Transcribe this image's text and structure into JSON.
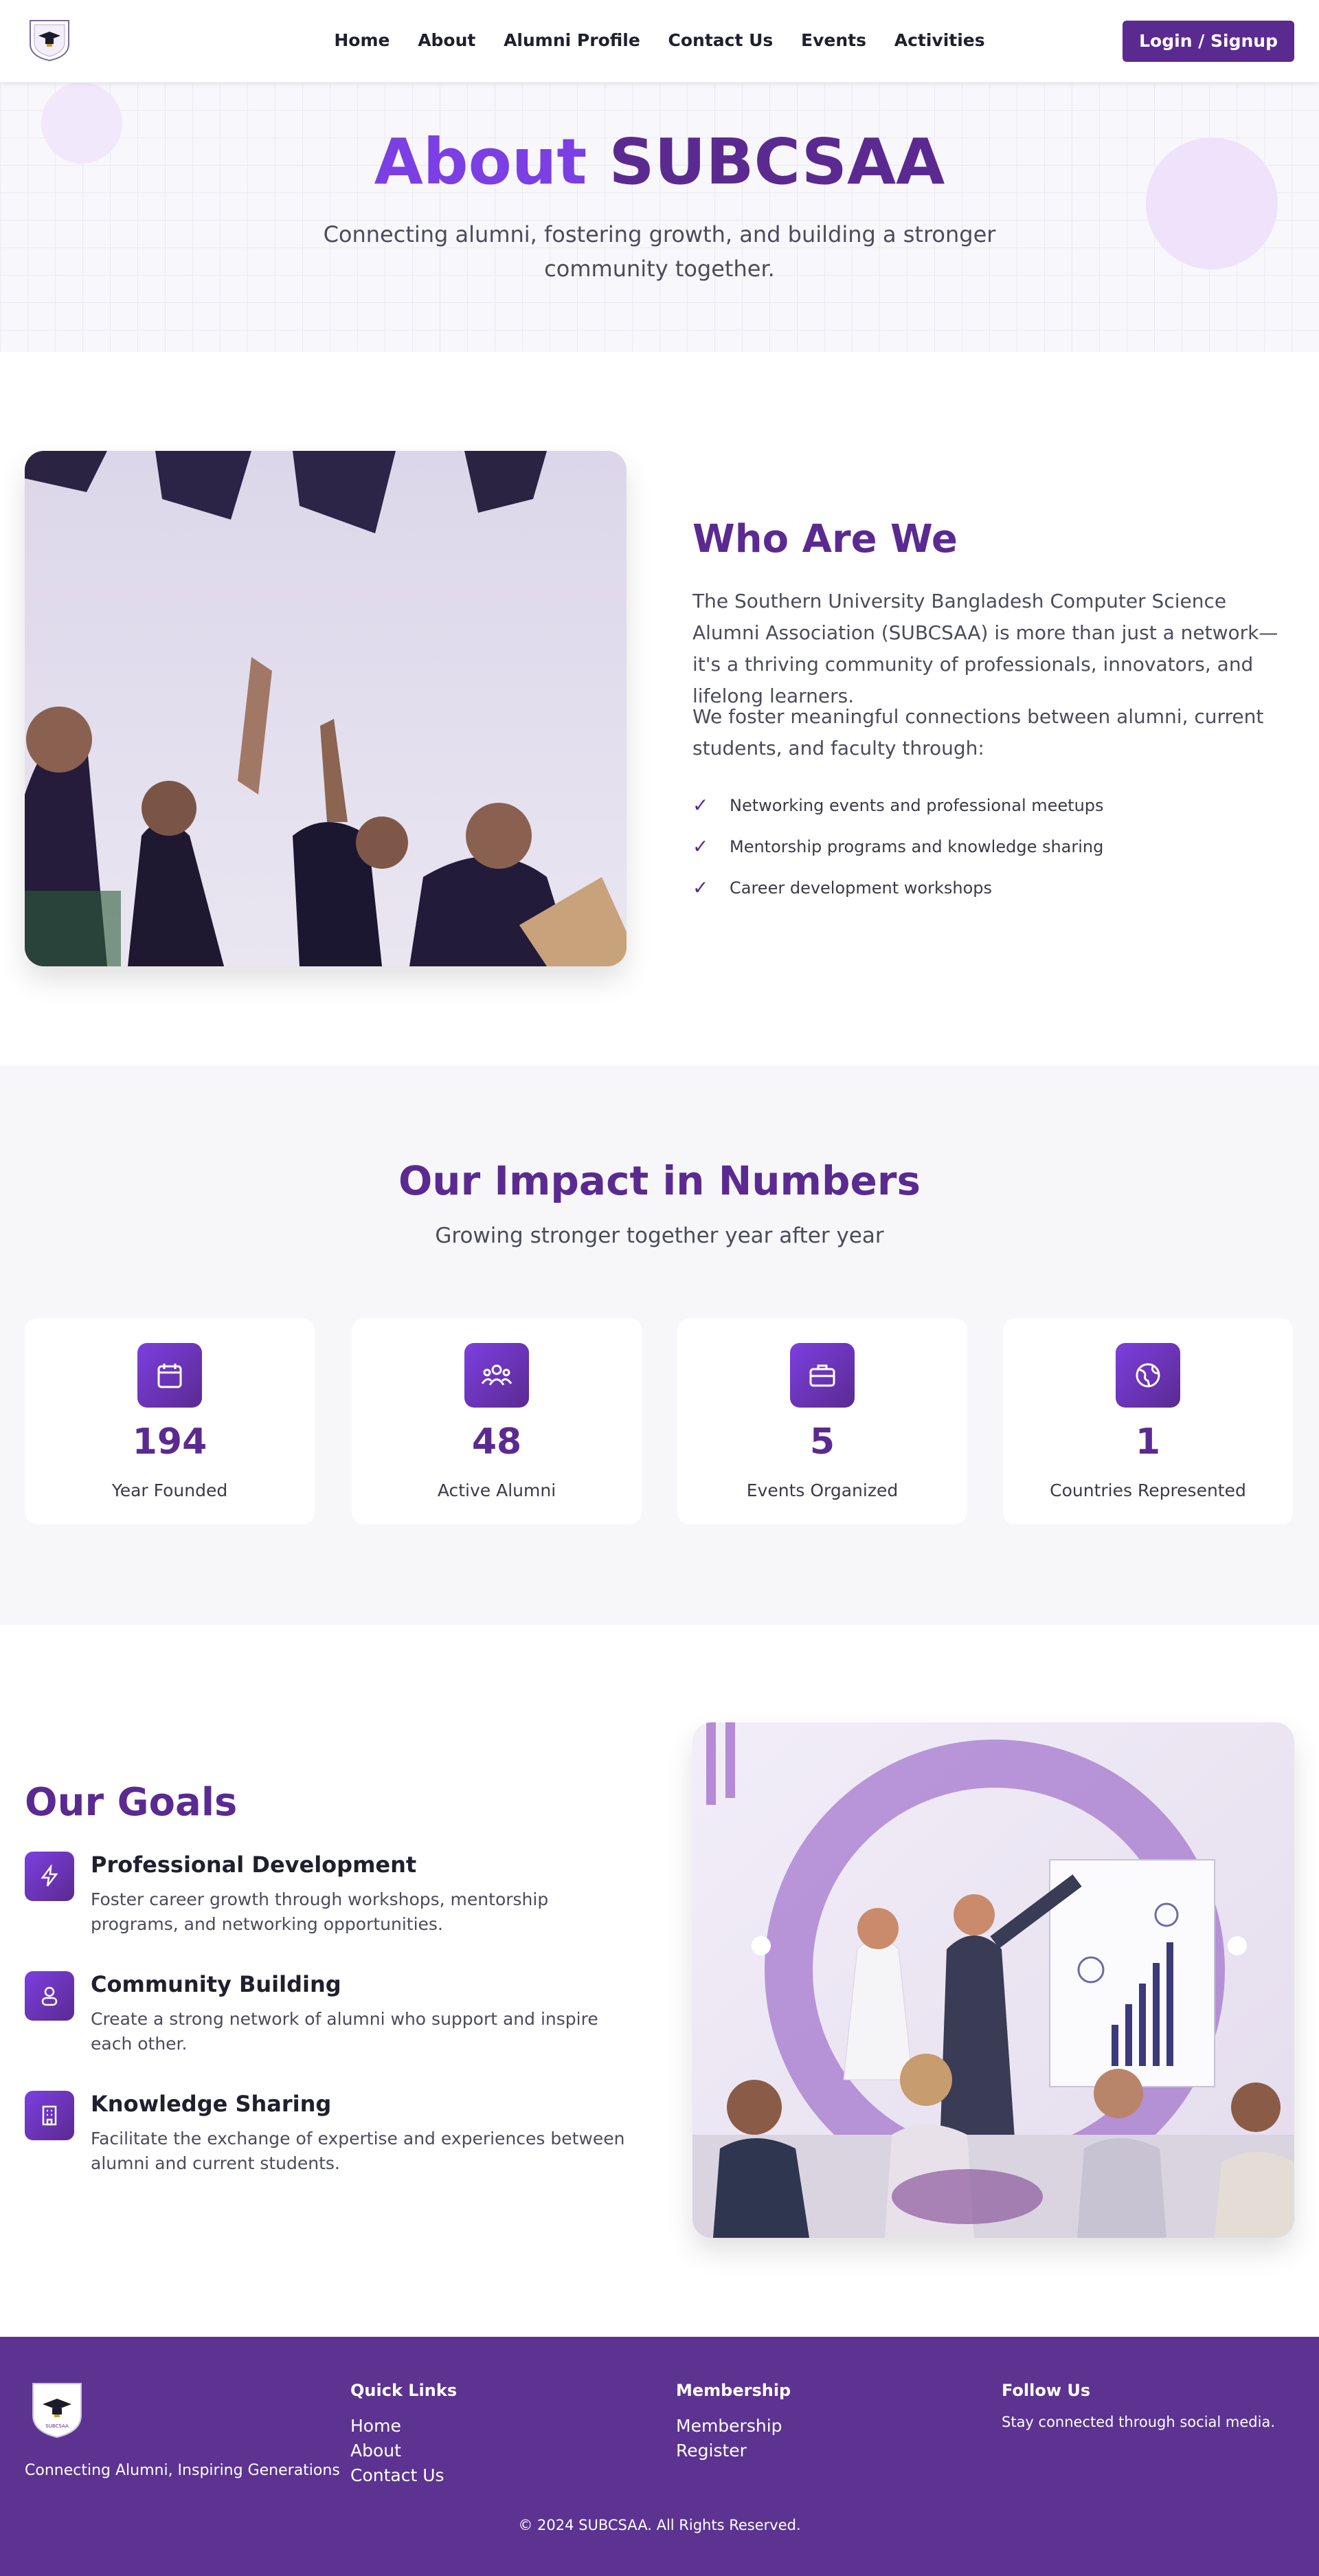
{
  "nav": {
    "links": [
      "Home",
      "About",
      "Alumni Profile",
      "Contact Us",
      "Events",
      "Activities"
    ],
    "login_label": "Login / Signup"
  },
  "hero": {
    "title_part1": "About",
    "title_part2": "SUBCSAA",
    "subtitle": "Connecting alumni, fostering growth, and building a stronger community together."
  },
  "who": {
    "title": "Who Are We",
    "paragraph1": "The Southern University Bangladesh Computer Science Alumni Association (SUBCSAA) is more than just a network—it's a thriving community of professionals, innovators, and lifelong learners.",
    "paragraph2": "We foster meaningful connections between alumni, current students, and faculty through:",
    "items": [
      "Networking events and professional meetups",
      "Mentorship programs and knowledge sharing",
      "Career development workshops"
    ]
  },
  "impact": {
    "title": "Our Impact in Numbers",
    "subtitle": "Growing stronger together year after year",
    "stats": [
      {
        "value": "194",
        "label": "Year Founded",
        "icon": "calendar-icon"
      },
      {
        "value": "48",
        "label": "Active Alumni",
        "icon": "users-icon"
      },
      {
        "value": "5",
        "label": "Events Organized",
        "icon": "briefcase-icon"
      },
      {
        "value": "1",
        "label": "Countries Represented",
        "icon": "globe-icon"
      }
    ]
  },
  "goals": {
    "title": "Our Goals",
    "items": [
      {
        "title": "Professional Development",
        "desc": "Foster career growth through workshops, mentorship programs, and networking opportunities.",
        "icon": "lightning-icon"
      },
      {
        "title": "Community Building",
        "desc": "Create a strong network of alumni who support and inspire each other.",
        "icon": "people-icon"
      },
      {
        "title": "Knowledge Sharing",
        "desc": "Facilitate the exchange of expertise and experiences between alumni and current students.",
        "icon": "building-icon"
      }
    ]
  },
  "footer": {
    "tagline": "Connecting Alumni, Inspiring Generations",
    "quick_links": {
      "heading": "Quick Links",
      "links": [
        "Home",
        "About",
        "Contact Us"
      ]
    },
    "membership": {
      "heading": "Membership",
      "links": [
        "Membership",
        "Register"
      ]
    },
    "follow": {
      "heading": "Follow Us",
      "text": "Stay connected through social media."
    },
    "copyright": "© 2024 SUBCSAA. All Rights Reserved.",
    "logo_text": "SUBCSAA"
  },
  "colors": {
    "primary": "#5b2a91",
    "accent": "#7b3fe4",
    "footer_bg": "#5c3391"
  }
}
